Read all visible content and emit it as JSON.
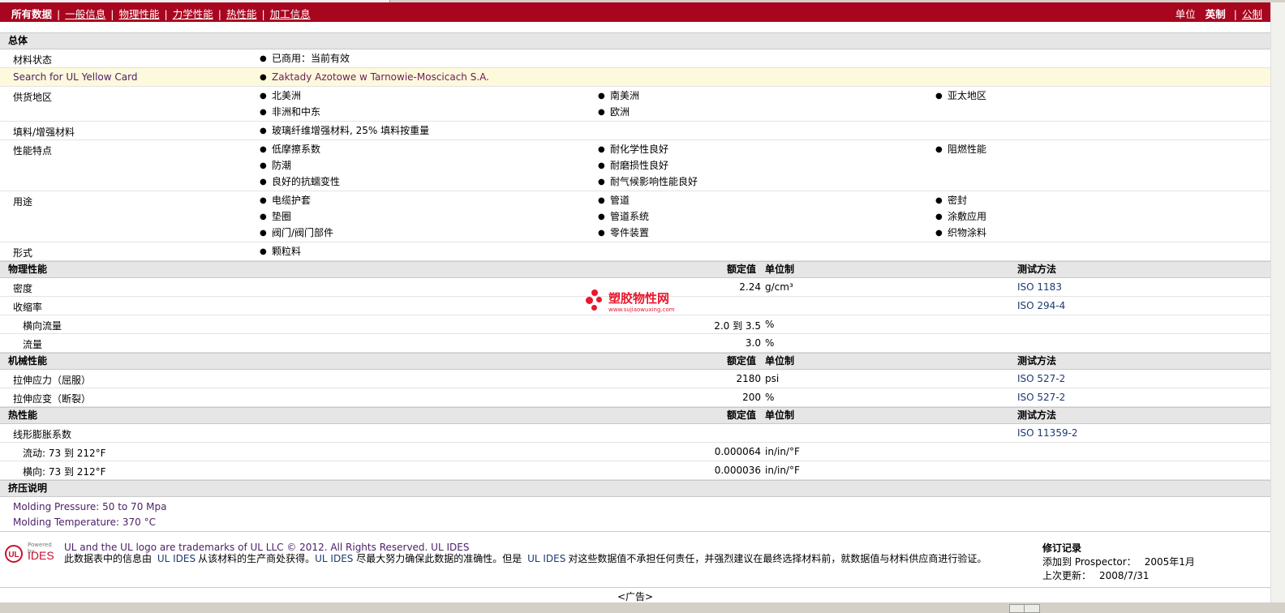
{
  "nav": {
    "current": "所有数据",
    "links": [
      "一般信息",
      "物理性能",
      "力学性能",
      "热性能",
      "加工信息"
    ],
    "units_label": "单位",
    "units_selected": "英制",
    "units_other": "公制",
    "colors": {
      "bar": "#a8051f"
    }
  },
  "general": {
    "section_title": "总体",
    "rows": [
      {
        "label": "材料状态",
        "cols": [
          [
            "已商用：当前有效"
          ]
        ]
      },
      {
        "label": "Search for UL Yellow Card",
        "cols": [
          [
            "Zaktady Azotowe w Tarnowie-Moscicach S.A."
          ]
        ],
        "highlight": true
      },
      {
        "label": "供货地区",
        "cols": [
          [
            "北美洲",
            "非洲和中东"
          ],
          [
            "南美洲",
            "欧洲"
          ],
          [
            "亚太地区"
          ]
        ]
      },
      {
        "label": "填料/增强材料",
        "cols": [
          [
            "玻璃纤维增强材料, 25% 填料按重量"
          ]
        ]
      },
      {
        "label": "性能特点",
        "cols": [
          [
            "低摩擦系数",
            "防潮",
            "良好的抗蠕变性"
          ],
          [
            "耐化学性良好",
            "耐磨损性良好",
            "耐气候影响性能良好"
          ],
          [
            "阻燃性能"
          ]
        ]
      },
      {
        "label": "用途",
        "cols": [
          [
            "电缆护套",
            "垫圈",
            "阀门/阀门部件"
          ],
          [
            "管道",
            "管道系统",
            "零件装置"
          ],
          [
            "密封",
            "涂敷应用",
            "织物涂料"
          ]
        ]
      },
      {
        "label": "形式",
        "cols": [
          [
            "颗粒料"
          ]
        ]
      }
    ]
  },
  "headers": {
    "nominal": "额定值",
    "unit": "单位制",
    "test": "测试方法"
  },
  "physical": {
    "section_title": "物理性能",
    "rows": [
      {
        "label": "密度",
        "value": "2.24",
        "unit": "g/cm³",
        "test": "ISO 1183"
      },
      {
        "label": "收缩率",
        "value": "",
        "unit": "",
        "test": "ISO 294-4"
      },
      {
        "label": "横向流量",
        "value": "2.0 到  3.5",
        "unit": "%",
        "test": "",
        "indent": true
      },
      {
        "label": "流量",
        "value": "3.0",
        "unit": "%",
        "test": "",
        "indent": true
      }
    ]
  },
  "mechanical": {
    "section_title": "机械性能",
    "rows": [
      {
        "label": "拉伸应力（屈服）",
        "value": "2180",
        "unit": "psi",
        "test": "ISO 527-2"
      },
      {
        "label": "拉伸应变（断裂）",
        "value": "200",
        "unit": "%",
        "test": "ISO 527-2"
      }
    ]
  },
  "thermal": {
    "section_title": "热性能",
    "rows": [
      {
        "label": "线形膨胀系数",
        "value": "",
        "unit": "",
        "test": "ISO 11359-2"
      },
      {
        "label": "流动: 73 到  212°F",
        "value": "0.000064",
        "unit": "in/in/°F",
        "test": "",
        "indent": true
      },
      {
        "label": "横向: 73 到  212°F",
        "value": "0.000036",
        "unit": "in/in/°F",
        "test": "",
        "indent": true
      }
    ]
  },
  "extrusion": {
    "section_title": "挤压说明",
    "lines": [
      "Molding Pressure: 50 to 70 Mpa",
      "Molding Temperature: 370 °C"
    ]
  },
  "footer": {
    "logo_powered": "Powered by",
    "logo_ul": "UL",
    "logo_ides": "IDES",
    "trademark": "UL and the UL logo are trademarks of UL LLC © 2012. All Rights Reserved. UL IDES",
    "disclaimer_1": "此数据表中的信息由",
    "disclaimer_link1": "UL IDES",
    "disclaimer_2": "从该材料的生产商处获得。",
    "disclaimer_link2": "UL IDES",
    "disclaimer_3": "尽最大努力确保此数据的准确性。但是",
    "disclaimer_link3": "UL IDES",
    "disclaimer_4": "对这些数据值不承担任何责任，并强烈建议在最终选择材料前，就数据值与材料供应商进行验证。",
    "revision": {
      "title": "修订记录",
      "added_label": "添加到  Prospector：",
      "added_value": "2005年1月",
      "updated_label": "上次更新：",
      "updated_value": "2008/7/31"
    }
  },
  "ad": "<广告>",
  "watermark": {
    "text": "塑胶物性网",
    "url": "www.sujiaowuxing.com"
  }
}
